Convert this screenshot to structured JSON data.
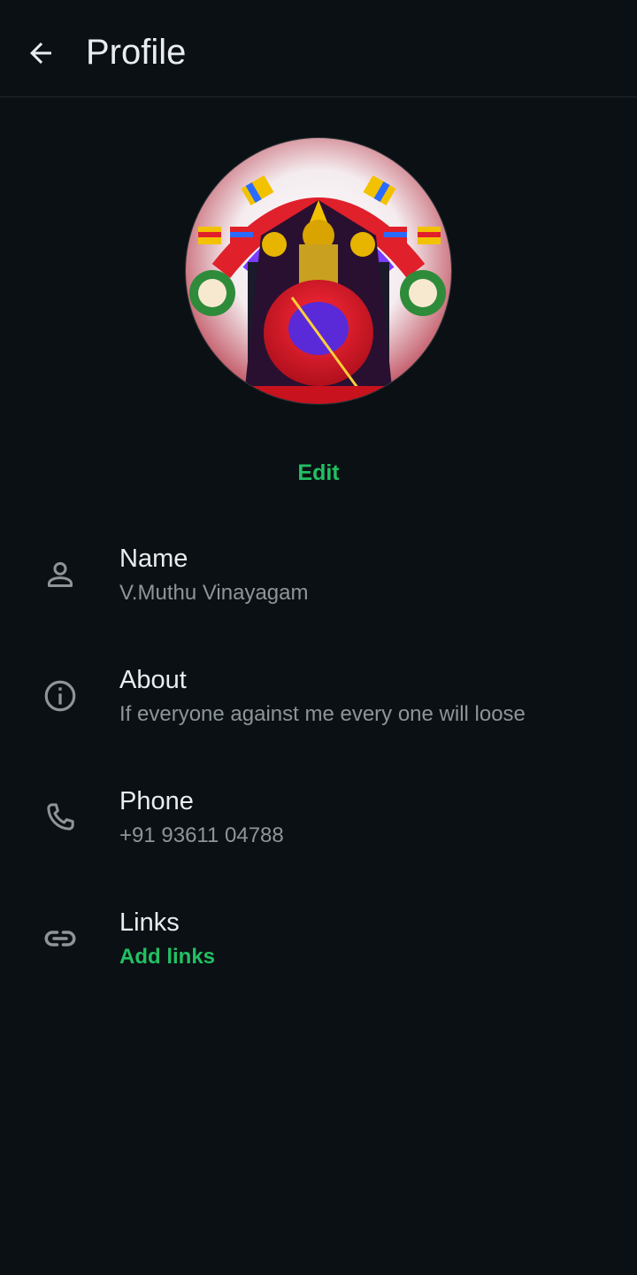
{
  "header": {
    "title": "Profile",
    "back_icon": "arrow-left-icon"
  },
  "avatar": {
    "description_icon": "profile-photo"
  },
  "edit_label": "Edit",
  "rows": [
    {
      "icon": "person-icon",
      "label": "Name",
      "value": "V.Muthu Vinayagam"
    },
    {
      "icon": "info-icon",
      "label": "About",
      "value": "If everyone against me every one will loose"
    },
    {
      "icon": "phone-icon",
      "label": "Phone",
      "value": "+91 93611 04788"
    },
    {
      "icon": "link-icon",
      "label": "Links",
      "value": "Add links"
    }
  ],
  "colors": {
    "background": "#0b1014",
    "accent": "#21c063",
    "primary_text": "#e9edef",
    "secondary_text": "#8d959a",
    "icon": "#8d959a"
  }
}
